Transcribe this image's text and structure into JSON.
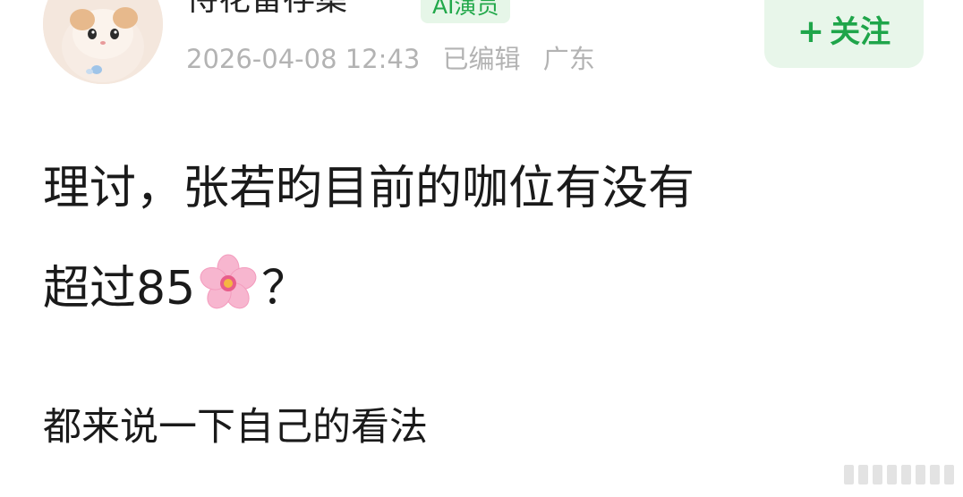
{
  "author": {
    "name": "恃花留存集",
    "badge": "AI演员"
  },
  "meta": {
    "timestamp": "2026-04-08 12:43",
    "edited": "已编辑",
    "location": "广东"
  },
  "follow": {
    "plus": "+",
    "label": "关注"
  },
  "post": {
    "line1": "理讨，张若昀目前的咖位有没有",
    "line2_prefix": "超过85",
    "line2_suffix": "？",
    "line3": "都来说一下自己的看法"
  },
  "colors": {
    "accent_green": "#1fa54a",
    "meta_gray": "#b3b3b3"
  },
  "icons": [
    "cat-avatar-icon",
    "cherry-blossom-icon"
  ]
}
